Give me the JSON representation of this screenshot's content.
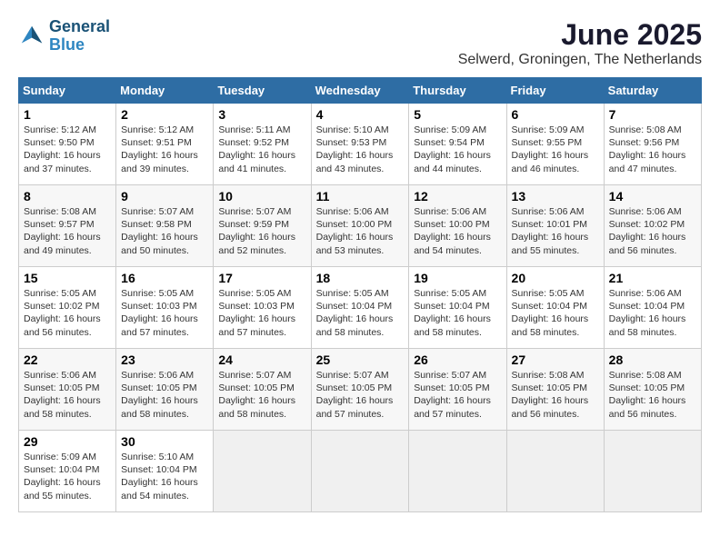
{
  "logo": {
    "line1": "General",
    "line2": "Blue"
  },
  "title": "June 2025",
  "location": "Selwerd, Groningen, The Netherlands",
  "headers": [
    "Sunday",
    "Monday",
    "Tuesday",
    "Wednesday",
    "Thursday",
    "Friday",
    "Saturday"
  ],
  "weeks": [
    [
      {
        "day": "1",
        "info": "Sunrise: 5:12 AM\nSunset: 9:50 PM\nDaylight: 16 hours\nand 37 minutes."
      },
      {
        "day": "2",
        "info": "Sunrise: 5:12 AM\nSunset: 9:51 PM\nDaylight: 16 hours\nand 39 minutes."
      },
      {
        "day": "3",
        "info": "Sunrise: 5:11 AM\nSunset: 9:52 PM\nDaylight: 16 hours\nand 41 minutes."
      },
      {
        "day": "4",
        "info": "Sunrise: 5:10 AM\nSunset: 9:53 PM\nDaylight: 16 hours\nand 43 minutes."
      },
      {
        "day": "5",
        "info": "Sunrise: 5:09 AM\nSunset: 9:54 PM\nDaylight: 16 hours\nand 44 minutes."
      },
      {
        "day": "6",
        "info": "Sunrise: 5:09 AM\nSunset: 9:55 PM\nDaylight: 16 hours\nand 46 minutes."
      },
      {
        "day": "7",
        "info": "Sunrise: 5:08 AM\nSunset: 9:56 PM\nDaylight: 16 hours\nand 47 minutes."
      }
    ],
    [
      {
        "day": "8",
        "info": "Sunrise: 5:08 AM\nSunset: 9:57 PM\nDaylight: 16 hours\nand 49 minutes."
      },
      {
        "day": "9",
        "info": "Sunrise: 5:07 AM\nSunset: 9:58 PM\nDaylight: 16 hours\nand 50 minutes."
      },
      {
        "day": "10",
        "info": "Sunrise: 5:07 AM\nSunset: 9:59 PM\nDaylight: 16 hours\nand 52 minutes."
      },
      {
        "day": "11",
        "info": "Sunrise: 5:06 AM\nSunset: 10:00 PM\nDaylight: 16 hours\nand 53 minutes."
      },
      {
        "day": "12",
        "info": "Sunrise: 5:06 AM\nSunset: 10:00 PM\nDaylight: 16 hours\nand 54 minutes."
      },
      {
        "day": "13",
        "info": "Sunrise: 5:06 AM\nSunset: 10:01 PM\nDaylight: 16 hours\nand 55 minutes."
      },
      {
        "day": "14",
        "info": "Sunrise: 5:06 AM\nSunset: 10:02 PM\nDaylight: 16 hours\nand 56 minutes."
      }
    ],
    [
      {
        "day": "15",
        "info": "Sunrise: 5:05 AM\nSunset: 10:02 PM\nDaylight: 16 hours\nand 56 minutes."
      },
      {
        "day": "16",
        "info": "Sunrise: 5:05 AM\nSunset: 10:03 PM\nDaylight: 16 hours\nand 57 minutes."
      },
      {
        "day": "17",
        "info": "Sunrise: 5:05 AM\nSunset: 10:03 PM\nDaylight: 16 hours\nand 57 minutes."
      },
      {
        "day": "18",
        "info": "Sunrise: 5:05 AM\nSunset: 10:04 PM\nDaylight: 16 hours\nand 58 minutes."
      },
      {
        "day": "19",
        "info": "Sunrise: 5:05 AM\nSunset: 10:04 PM\nDaylight: 16 hours\nand 58 minutes."
      },
      {
        "day": "20",
        "info": "Sunrise: 5:05 AM\nSunset: 10:04 PM\nDaylight: 16 hours\nand 58 minutes."
      },
      {
        "day": "21",
        "info": "Sunrise: 5:06 AM\nSunset: 10:04 PM\nDaylight: 16 hours\nand 58 minutes."
      }
    ],
    [
      {
        "day": "22",
        "info": "Sunrise: 5:06 AM\nSunset: 10:05 PM\nDaylight: 16 hours\nand 58 minutes."
      },
      {
        "day": "23",
        "info": "Sunrise: 5:06 AM\nSunset: 10:05 PM\nDaylight: 16 hours\nand 58 minutes."
      },
      {
        "day": "24",
        "info": "Sunrise: 5:07 AM\nSunset: 10:05 PM\nDaylight: 16 hours\nand 58 minutes."
      },
      {
        "day": "25",
        "info": "Sunrise: 5:07 AM\nSunset: 10:05 PM\nDaylight: 16 hours\nand 57 minutes."
      },
      {
        "day": "26",
        "info": "Sunrise: 5:07 AM\nSunset: 10:05 PM\nDaylight: 16 hours\nand 57 minutes."
      },
      {
        "day": "27",
        "info": "Sunrise: 5:08 AM\nSunset: 10:05 PM\nDaylight: 16 hours\nand 56 minutes."
      },
      {
        "day": "28",
        "info": "Sunrise: 5:08 AM\nSunset: 10:05 PM\nDaylight: 16 hours\nand 56 minutes."
      }
    ],
    [
      {
        "day": "29",
        "info": "Sunrise: 5:09 AM\nSunset: 10:04 PM\nDaylight: 16 hours\nand 55 minutes."
      },
      {
        "day": "30",
        "info": "Sunrise: 5:10 AM\nSunset: 10:04 PM\nDaylight: 16 hours\nand 54 minutes."
      },
      null,
      null,
      null,
      null,
      null
    ]
  ]
}
